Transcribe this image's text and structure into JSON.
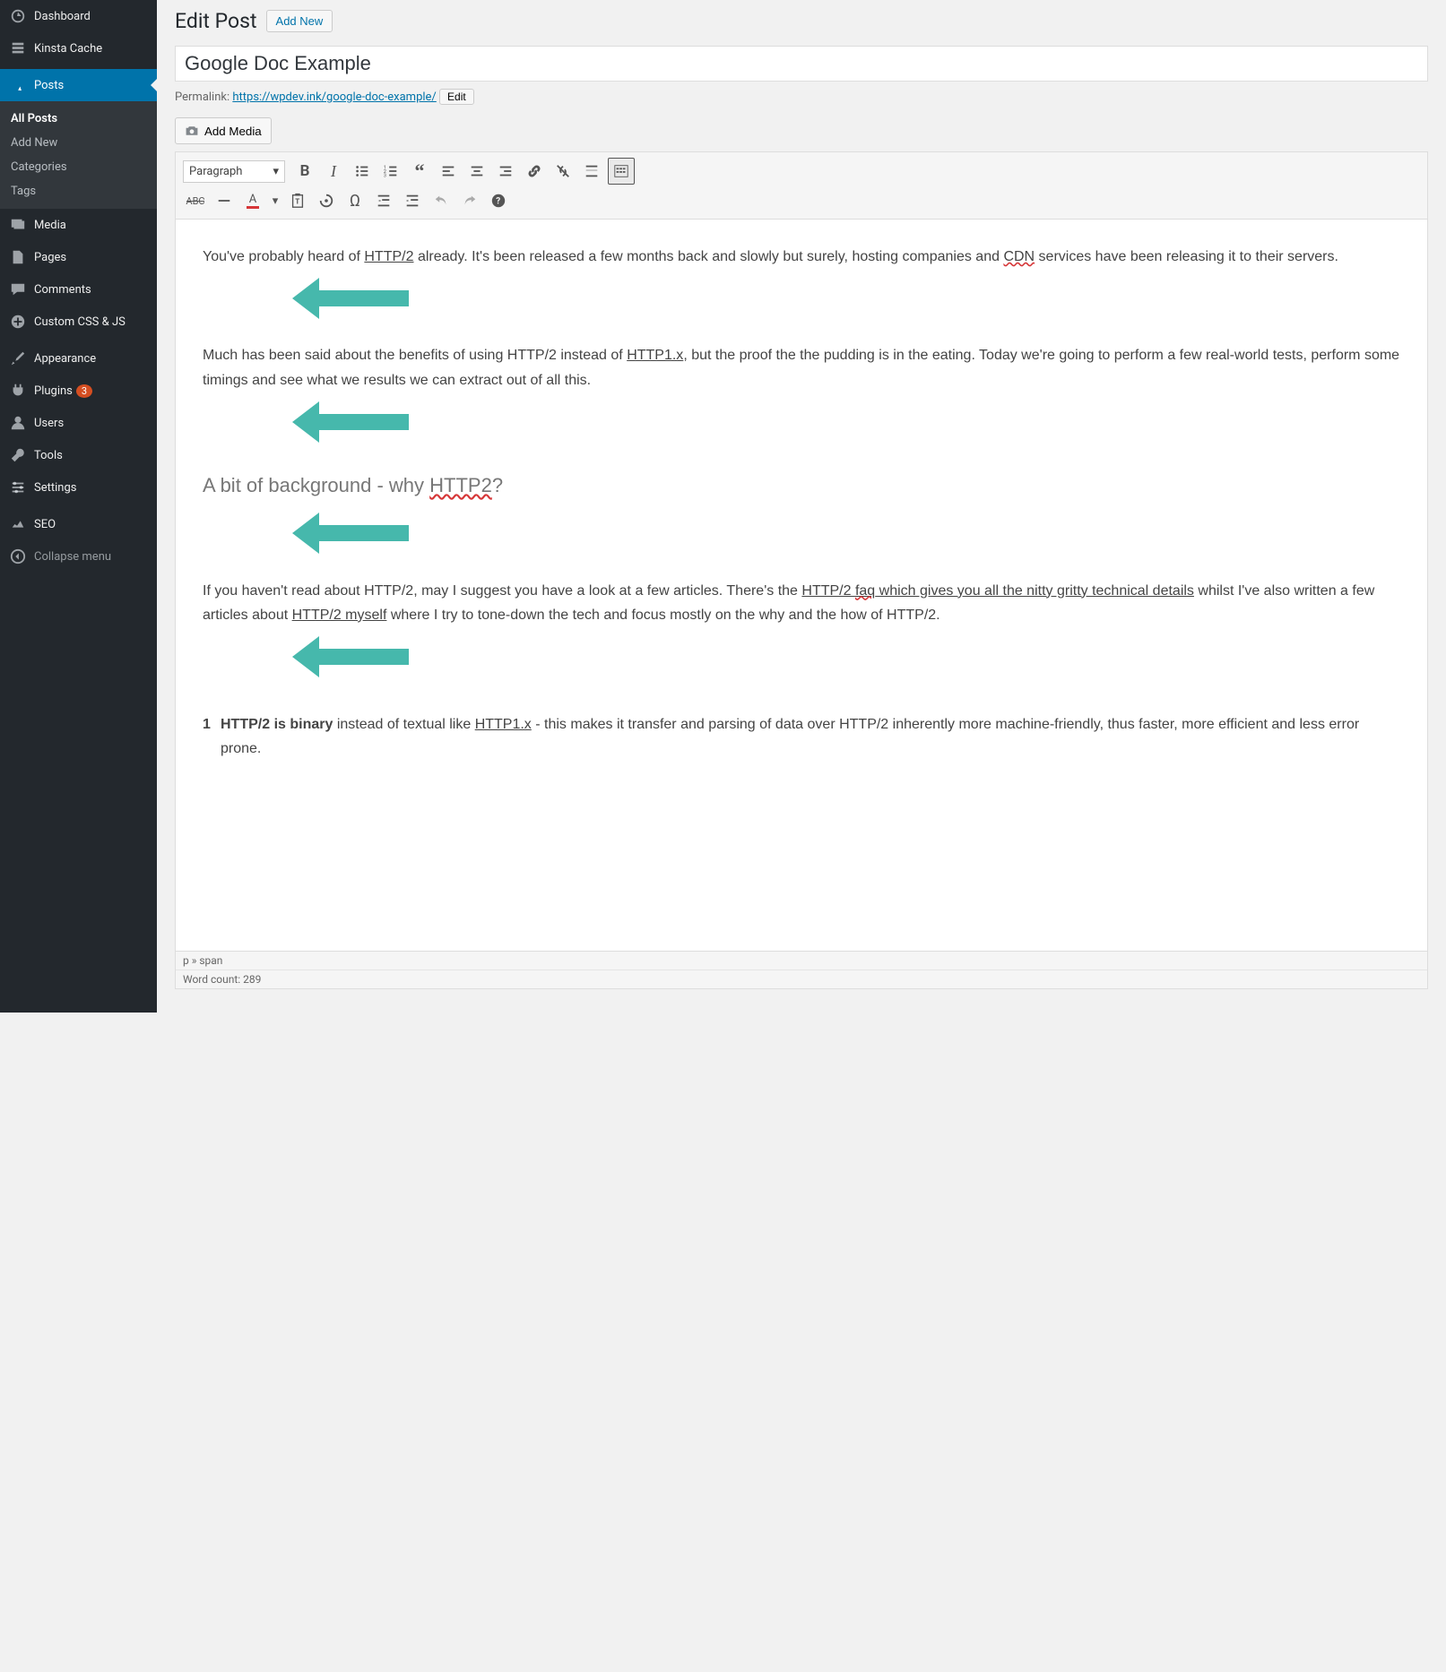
{
  "sidebar": {
    "dashboard": "Dashboard",
    "kinsta_cache": "Kinsta Cache",
    "posts": "Posts",
    "all_posts": "All Posts",
    "add_new": "Add New",
    "categories": "Categories",
    "tags": "Tags",
    "media": "Media",
    "pages": "Pages",
    "comments": "Comments",
    "custom_css": "Custom CSS & JS",
    "appearance": "Appearance",
    "plugins": "Plugins",
    "plugins_count": "3",
    "users": "Users",
    "tools": "Tools",
    "settings": "Settings",
    "seo": "SEO",
    "collapse": "Collapse menu"
  },
  "header": {
    "title": "Edit Post",
    "add_new": "Add New"
  },
  "post": {
    "title": "Google Doc Example",
    "permalink_label": "Permalink: ",
    "permalink_base": "https://wpdev.ink/",
    "permalink_slug": "google-doc-example/",
    "edit": "Edit",
    "add_media": "Add Media",
    "format_select": "Paragraph"
  },
  "content": {
    "p1": "You've probably heard of HTTP/2 already. It's been released a few months back and slowly but surely, hosting companies and CDN services have been releasing it to their servers.",
    "p2": "Much has been said about the benefits of using HTTP/2 instead of HTTP1.x, but the proof the the pudding is in the eating. Today we're going to perform a few real-world tests, perform some timings and see what we results we can extract out of all this.",
    "h2": "A bit of background - why HTTP2?",
    "p3": "If you haven't read about HTTP/2, may I suggest you have a look at a few articles. There's the HTTP/2 faq which gives you all the nitty gritty technical details whilst I've also written a few articles about HTTP/2 myself where I try to tone-down the tech and focus mostly on the why and the how of HTTP/2.",
    "ol_num": "1",
    "ol_p": "HTTP/2 is binary instead of textual like HTTP1.x - this makes it transfer and parsing of data over HTTP/2 inherently more machine-friendly, thus faster, more efficient and less error prone."
  },
  "status": {
    "path": "p » span",
    "wordcount": "Word count: 289"
  }
}
